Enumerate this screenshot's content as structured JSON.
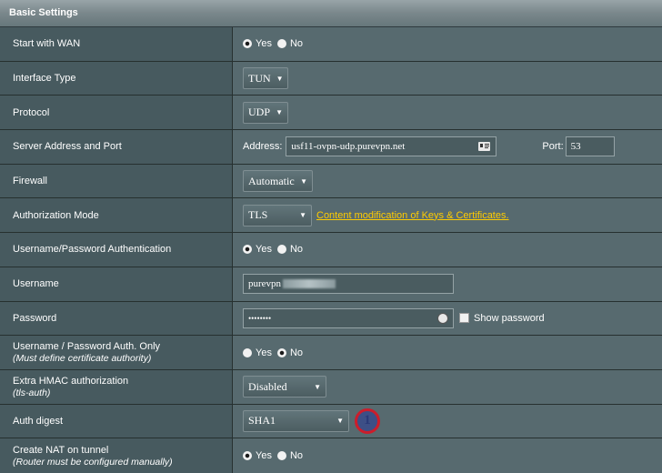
{
  "header": {
    "title": "Basic Settings"
  },
  "rows": {
    "start_wan": {
      "label": "Start with WAN",
      "yes": "Yes",
      "no": "No",
      "selected": "Yes"
    },
    "interface_type": {
      "label": "Interface Type",
      "value": "TUN"
    },
    "protocol": {
      "label": "Protocol",
      "value": "UDP"
    },
    "server": {
      "label": "Server Address and Port",
      "address_label": "Address:",
      "address_value": "usf11-ovpn-udp.purevpn.net",
      "port_label": "Port:",
      "port_value": "53"
    },
    "firewall": {
      "label": "Firewall",
      "value": "Automatic"
    },
    "auth_mode": {
      "label": "Authorization Mode",
      "value": "TLS",
      "link": "Content modification of Keys & Certificates."
    },
    "userpass_auth": {
      "label": "Username/Password Authentication",
      "yes": "Yes",
      "no": "No",
      "selected": "Yes"
    },
    "username": {
      "label": "Username",
      "value": "purevpn"
    },
    "password": {
      "label": "Password",
      "value": "••••••••",
      "show_label": "Show password"
    },
    "userpass_only": {
      "label": "Username / Password Auth. Only",
      "sub": "(Must define certificate authority)",
      "yes": "Yes",
      "no": "No",
      "selected": "No"
    },
    "hmac": {
      "label": "Extra HMAC authorization",
      "sub": "(tls-auth)",
      "value": "Disabled"
    },
    "auth_digest": {
      "label": "Auth digest",
      "value": "SHA1",
      "badge": "1"
    },
    "nat": {
      "label": "Create NAT on tunnel",
      "sub": "(Router must be configured manually)",
      "yes": "Yes",
      "no": "No",
      "selected": "Yes"
    }
  },
  "colors": {
    "accent_link": "#ffcc00",
    "badge_ring": "#cc1d2b"
  }
}
